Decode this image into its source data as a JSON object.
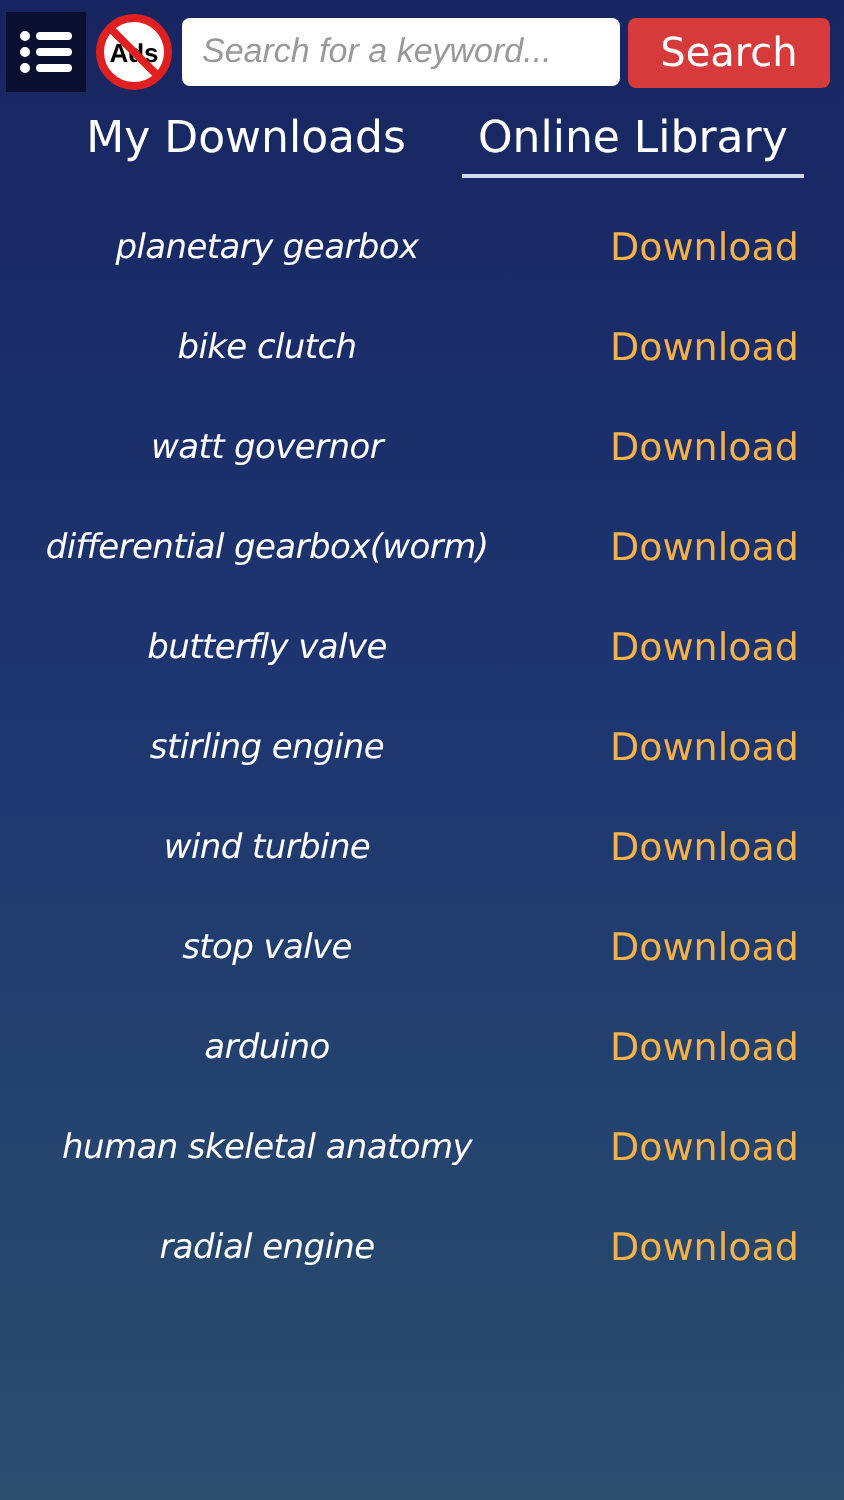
{
  "toolbar": {
    "no_ads_label": "Ads",
    "search": {
      "placeholder": "Search for a keyword..."
    },
    "search_button": "Search"
  },
  "tabs": [
    {
      "label": "My Downloads",
      "selected": false
    },
    {
      "label": "Online Library",
      "selected": true
    }
  ],
  "models": [
    {
      "name": "planetary gearbox",
      "action": "Download"
    },
    {
      "name": "bike clutch",
      "action": "Download"
    },
    {
      "name": "watt governor",
      "action": "Download"
    },
    {
      "name": "differential gearbox(worm)",
      "action": "Download"
    },
    {
      "name": "butterfly valve",
      "action": "Download"
    },
    {
      "name": "stirling engine",
      "action": "Download"
    },
    {
      "name": "wind turbine",
      "action": "Download"
    },
    {
      "name": "stop valve",
      "action": "Download"
    },
    {
      "name": "arduino",
      "action": "Download"
    },
    {
      "name": "human skeletal anatomy",
      "action": "Download"
    },
    {
      "name": "radial engine",
      "action": "Download"
    }
  ]
}
